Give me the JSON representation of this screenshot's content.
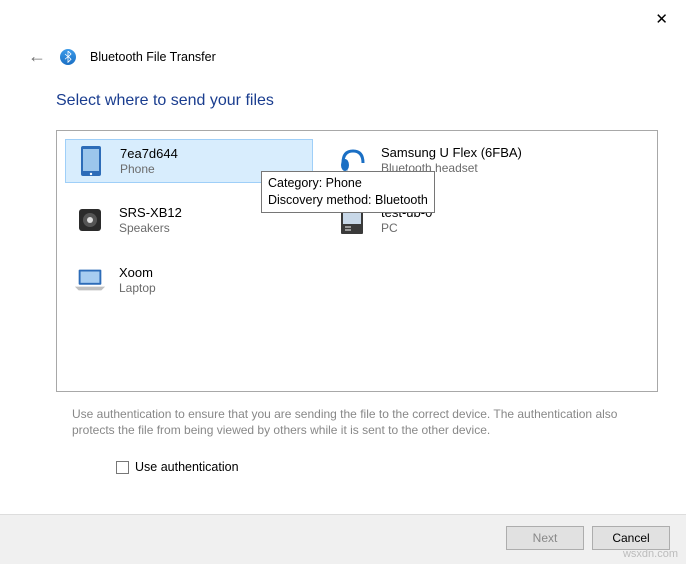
{
  "window": {
    "title": "Bluetooth File Transfer",
    "heading": "Select where to send your files"
  },
  "devices": [
    {
      "name": "7ea7d644",
      "type": "Phone",
      "selected": true
    },
    {
      "name": "Samsung U Flex (6FBA)",
      "type": "Bluetooth headset",
      "selected": false
    },
    {
      "name": "SRS-XB12",
      "type": "Speakers",
      "selected": false
    },
    {
      "name": "test-ub-0",
      "type": "PC",
      "selected": false
    },
    {
      "name": "Xoom",
      "type": "Laptop",
      "selected": false
    }
  ],
  "tooltip": {
    "line1": "Category: Phone",
    "line2": "Discovery method: Bluetooth"
  },
  "hint": "Use authentication to ensure that you are sending the file to the correct device. The authentication also protects the file from being viewed by others while it is sent to the other device.",
  "auth_checkbox_label": "Use authentication",
  "buttons": {
    "next": "Next",
    "cancel": "Cancel"
  },
  "watermark": "wsxdn.com"
}
